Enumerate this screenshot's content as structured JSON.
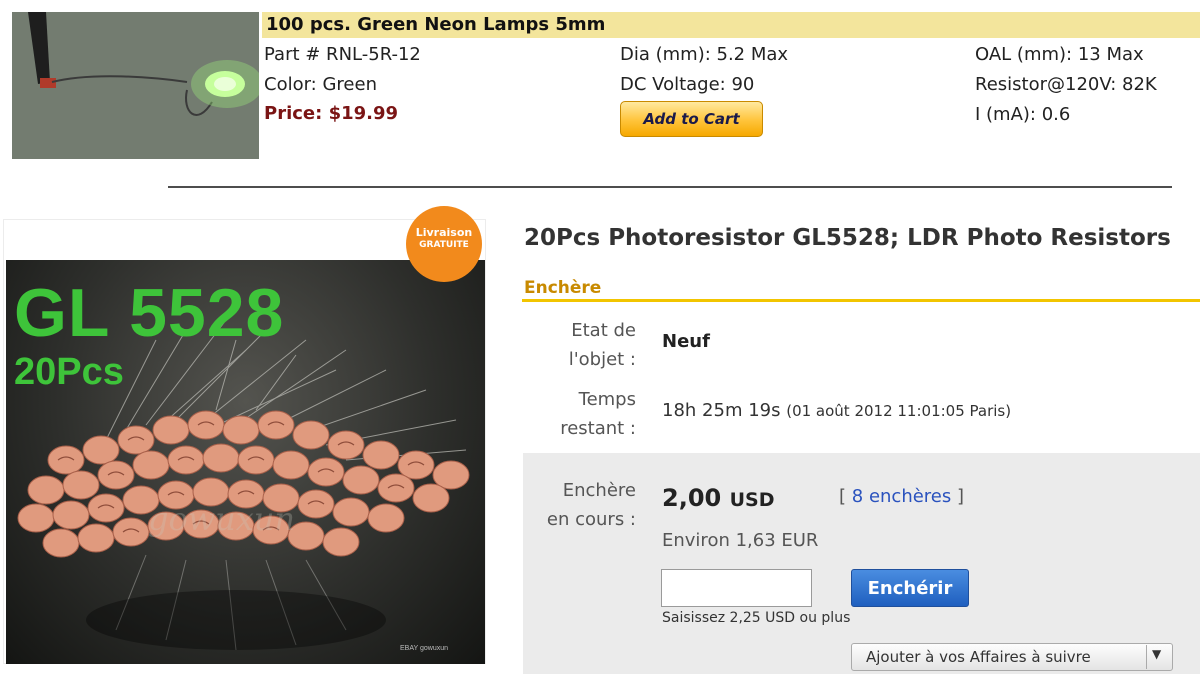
{
  "product1": {
    "title": "100 pcs. Green Neon Lamps 5mm",
    "part": "Part # RNL-5R-12",
    "color": "Color: Green",
    "price": "Price: $19.99",
    "dia": "Dia (mm): 5.2 Max",
    "dc_voltage": "DC Voltage: 90",
    "add_to_cart": "Add to Cart",
    "oal": "OAL (mm): 13 Max",
    "resistor": "Resistor@120V: 82K",
    "current": "I (mA): 0.6"
  },
  "product2": {
    "image": {
      "big_text": "GL 5528",
      "sub_text": "20Pcs",
      "badge_line1": "Livraison",
      "badge_line2": "GRATUITE",
      "watermark": "gowuxun",
      "ebay_tag": "EBAY gowuxun"
    },
    "title": "20Pcs Photoresistor GL5528; LDR Photo Resistors",
    "section_label": "Enchère",
    "condition_label_1": "Etat de",
    "condition_label_2": "l'objet :",
    "condition_value": "Neuf",
    "time_label_1": "Temps",
    "time_label_2": "restant :",
    "time_value": "18h 25m 19s",
    "time_end": "(01 août 2012 11:01:05 Paris)",
    "bid_label_1": "Enchère",
    "bid_label_2": "en cours :",
    "bid_amount": "2,00",
    "bid_currency": "USD",
    "bids_open": "[",
    "bids_link": "8 enchères",
    "bids_close": "]",
    "approx": "Environ 1,63 EUR",
    "bid_input_value": "",
    "bid_button": "Enchérir",
    "hint": "Saisissez 2,25 USD ou plus",
    "watch_button": "Ajouter à vos Affaires à suivre"
  },
  "colors": {
    "title_highlight": "#f3e59c",
    "price": "#7a1414",
    "section_accent": "#f2c500",
    "link": "#2a52be",
    "bid_button": "#1f5fbf",
    "image_text_green": "#3ec43a",
    "badge_orange": "#f28a1c"
  },
  "icons": {
    "watch_dropdown": "chevron-down-icon"
  }
}
